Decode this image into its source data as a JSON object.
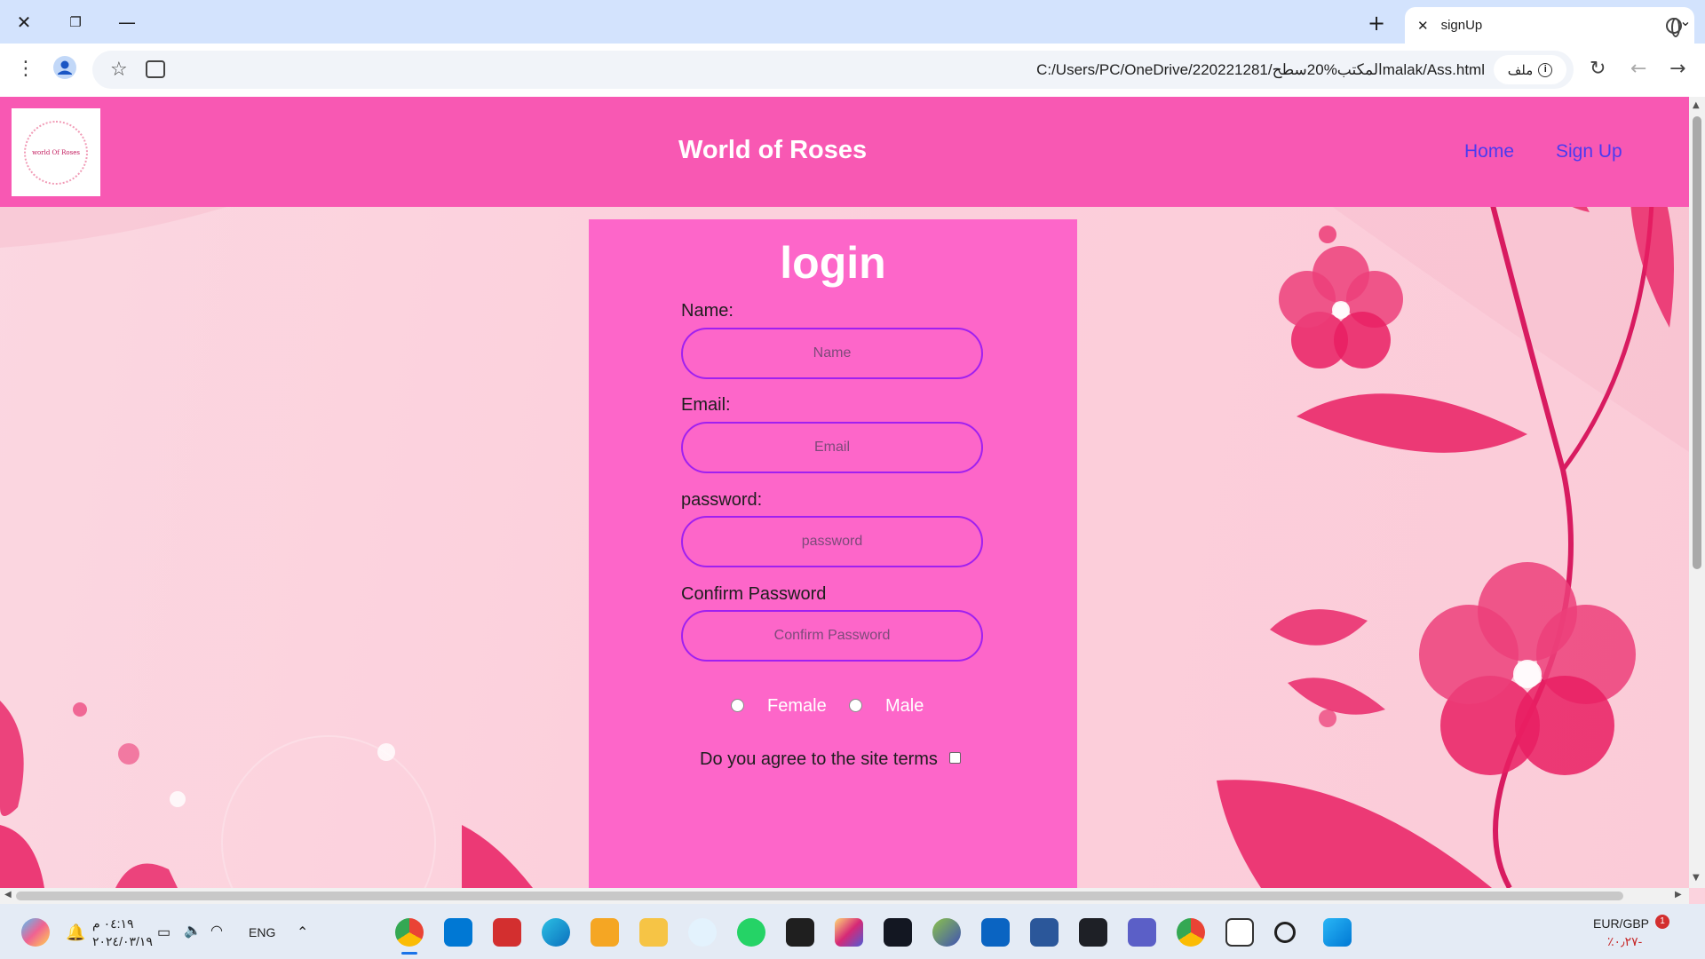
{
  "browser": {
    "tab_title": "signUp",
    "address": "C:/Users/PC/OneDrive/220221281/المكتب%20سطحmalak/Ass.html",
    "address_chip": "ملف"
  },
  "site": {
    "logo_text": "world Of Roses",
    "title": "World of Roses",
    "nav": [
      {
        "label": "Home"
      },
      {
        "label": "Sign Up"
      }
    ],
    "link_color": "#4a3bf0",
    "header_color": "#f858b3"
  },
  "form": {
    "title": "login",
    "card_color": "#fd66c9",
    "fields": [
      {
        "label": "Name:",
        "placeholder": "Name"
      },
      {
        "label": "Email:",
        "placeholder": "Email"
      },
      {
        "label": "password:",
        "placeholder": "password"
      },
      {
        "label": "Confirm Password",
        "placeholder": "Confirm Password"
      }
    ],
    "gender": [
      {
        "label": "Female"
      },
      {
        "label": "Male"
      }
    ],
    "terms": "Do you agree to the site terms"
  },
  "taskbar": {
    "time": "٠٤:١٩ م",
    "date": "٢٠٢٤/٠٣/١٩",
    "lang": "ENG",
    "ticker_name": "EUR/GBP",
    "ticker_value": "٪٠٫٢٧-",
    "ticker_badge": "1",
    "apps": [
      "chrome-icon",
      "vscode-icon",
      "acrobat-icon",
      "edge-icon",
      "box-icon",
      "file-explorer-icon",
      "app-store-icon",
      "whatsapp-icon",
      "jetbrains-icon",
      "instagram-icon",
      "tradingview-icon",
      "globe-app-icon",
      "outlook-icon",
      "store-icon",
      "binance-icon",
      "teams-icon",
      "chrome-alt-icon",
      "window-icon",
      "search-icon",
      "windows-icon"
    ]
  }
}
